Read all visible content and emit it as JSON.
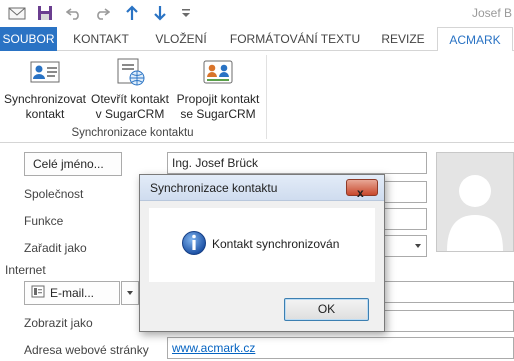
{
  "qat": {
    "user": "Josef B",
    "icons": [
      "envelope-icon",
      "save-icon",
      "undo-icon",
      "redo-icon",
      "up-arrow-icon",
      "down-arrow-icon",
      "customize-dropdown-icon"
    ]
  },
  "tabs": [
    {
      "label": "SOUBOR"
    },
    {
      "label": "KONTAKT"
    },
    {
      "label": "VLOŽENÍ"
    },
    {
      "label": "FORMÁTOVÁNÍ TEXTU"
    },
    {
      "label": "REVIZE"
    },
    {
      "label": "ACMARK"
    }
  ],
  "ribbon": {
    "buttons": [
      {
        "line1": "Synchronizovat",
        "line2": "kontakt",
        "icon": "contact-card-icon"
      },
      {
        "line1": "Otevřít kontakt",
        "line2": "v SugarCRM",
        "icon": "globe-document-icon"
      },
      {
        "line1": "Propojit kontakt",
        "line2": "se SugarCRM",
        "icon": "link-contacts-icon"
      }
    ],
    "group_label": "Synchronizace kontaktu"
  },
  "form": {
    "full_name_button": "Celé jméno...",
    "full_name_value": "Ing. Josef Brück",
    "company_label": "Společnost",
    "job_label": "Funkce",
    "file_as_label": "Zařadit jako",
    "internet_label": "Internet",
    "email_button": "E-mail...",
    "display_as_label": "Zobrazit jako",
    "web_label": "Adresa webové stránky",
    "web_value": "www.acmark.cz"
  },
  "dialog": {
    "title": "Synchronizace kontaktu",
    "message": "Kontakt synchronizován",
    "ok_label": "OK",
    "close_label": "x"
  },
  "colors": {
    "file_tab": "#2a73c4",
    "active_tab_text": "#2a73c4",
    "link": "#0563c1"
  }
}
